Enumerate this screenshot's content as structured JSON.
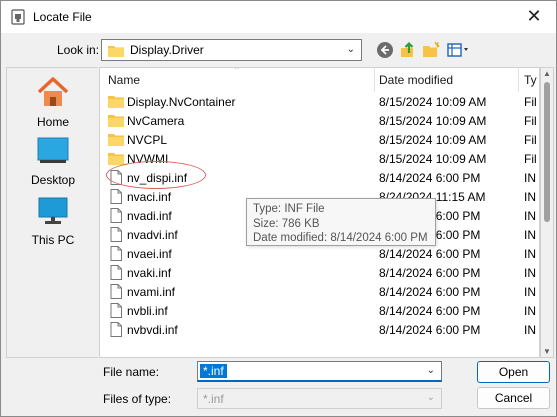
{
  "window": {
    "title": "Locate File",
    "close": "✕"
  },
  "lookin": {
    "label": "Look in:",
    "value": "Display.Driver"
  },
  "toolbar": {
    "back_icon": "back-arrow-icon",
    "up_icon": "up-folder-icon",
    "new_folder_icon": "new-folder-icon",
    "view_icon": "view-menu-icon"
  },
  "places": [
    {
      "label": "Home",
      "icon": "home-icon"
    },
    {
      "label": "Desktop",
      "icon": "desktop-icon"
    },
    {
      "label": "This PC",
      "icon": "this-pc-icon"
    }
  ],
  "columns": {
    "name": "Name",
    "date": "Date modified",
    "type": "Ty"
  },
  "files": [
    {
      "name": "Display.NvContainer",
      "date": "8/15/2024 10:09 AM",
      "type": "Fil",
      "kind": "folder"
    },
    {
      "name": "NvCamera",
      "date": "8/15/2024 10:09 AM",
      "type": "Fil",
      "kind": "folder"
    },
    {
      "name": "NVCPL",
      "date": "8/15/2024 10:09 AM",
      "type": "Fil",
      "kind": "folder"
    },
    {
      "name": "NVWMI",
      "date": "8/15/2024 10:09 AM",
      "type": "Fil",
      "kind": "folder"
    },
    {
      "name": "nv_dispi.inf",
      "date": "8/14/2024 6:00 PM",
      "type": "IN",
      "kind": "file"
    },
    {
      "name": "nvaci.inf",
      "date": "8/24/2024 11:15 AM",
      "type": "IN",
      "kind": "file"
    },
    {
      "name": "nvadi.inf",
      "date": "8/14/2024 6:00 PM",
      "type": "IN",
      "kind": "file"
    },
    {
      "name": "nvadvi.inf",
      "date": "8/14/2024 6:00 PM",
      "type": "IN",
      "kind": "file"
    },
    {
      "name": "nvaei.inf",
      "date": "8/14/2024 6:00 PM",
      "type": "IN",
      "kind": "file"
    },
    {
      "name": "nvaki.inf",
      "date": "8/14/2024 6:00 PM",
      "type": "IN",
      "kind": "file"
    },
    {
      "name": "nvami.inf",
      "date": "8/14/2024 6:00 PM",
      "type": "IN",
      "kind": "file"
    },
    {
      "name": "nvbli.inf",
      "date": "8/14/2024 6:00 PM",
      "type": "IN",
      "kind": "file"
    },
    {
      "name": "nvbvdi.inf",
      "date": "8/14/2024 6:00 PM",
      "type": "IN",
      "kind": "file"
    }
  ],
  "tooltip": {
    "type": "Type: INF File",
    "size": "Size: 786 KB",
    "date": "Date modified: 8/14/2024 6:00 PM"
  },
  "filename": {
    "label": "File name:",
    "value": "*.inf"
  },
  "filetype": {
    "label": "Files of type:",
    "value": "*.inf"
  },
  "buttons": {
    "open": "Open",
    "cancel": "Cancel"
  },
  "colors": {
    "accent": "#0067c0",
    "folder": "#f6c344",
    "annotation": "#e06060"
  }
}
